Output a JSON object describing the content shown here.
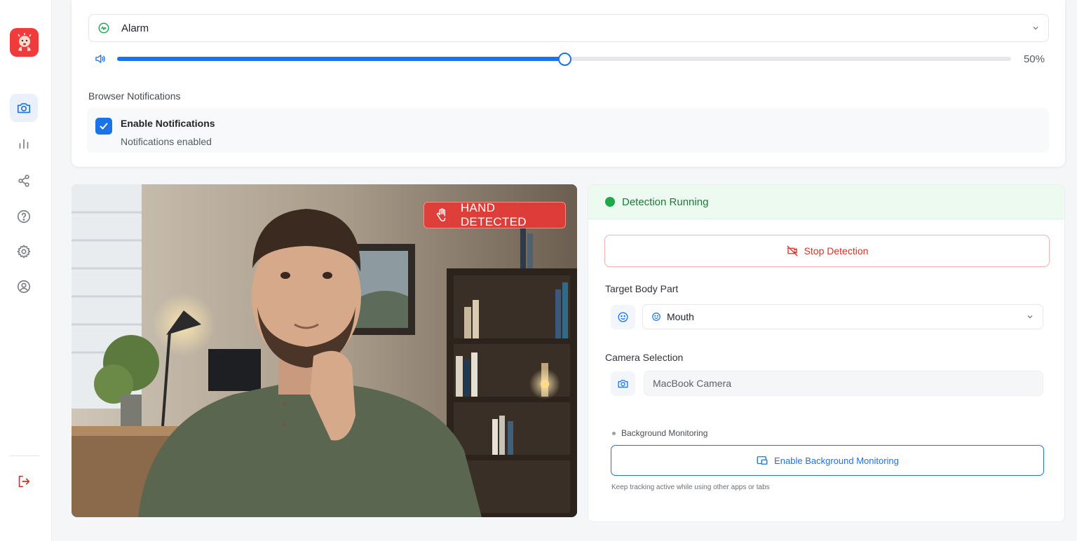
{
  "sidebar": {
    "items": [
      {
        "icon": "camera-icon",
        "active": true
      },
      {
        "icon": "bar-chart-icon",
        "active": false
      },
      {
        "icon": "share-icon",
        "active": false
      },
      {
        "icon": "help-icon",
        "active": false
      },
      {
        "icon": "settings-icon",
        "active": false
      },
      {
        "icon": "profile-icon",
        "active": false
      }
    ],
    "logout_icon": "logout-icon"
  },
  "sound": {
    "selected": "Alarm",
    "volume_percent": 50,
    "volume_label": "50%"
  },
  "notifications": {
    "section_label": "Browser Notifications",
    "checkbox_label": "Enable Notifications",
    "checked": true,
    "status": "Notifications enabled"
  },
  "camera": {
    "badge": "HAND DETECTED"
  },
  "detection": {
    "status": "Detection Running",
    "stop_label": "Stop Detection",
    "target_label": "Target Body Part",
    "target_value": "Mouth",
    "camera_label": "Camera Selection",
    "camera_value": "MacBook Camera",
    "bg_label": "Background Monitoring",
    "bg_button": "Enable Background Monitoring",
    "bg_hint": "Keep tracking active while using other apps or tabs"
  },
  "colors": {
    "accent": "#1a73e8",
    "danger": "#d93025",
    "success": "#1ea84a",
    "brand": "#ef3b3b"
  }
}
